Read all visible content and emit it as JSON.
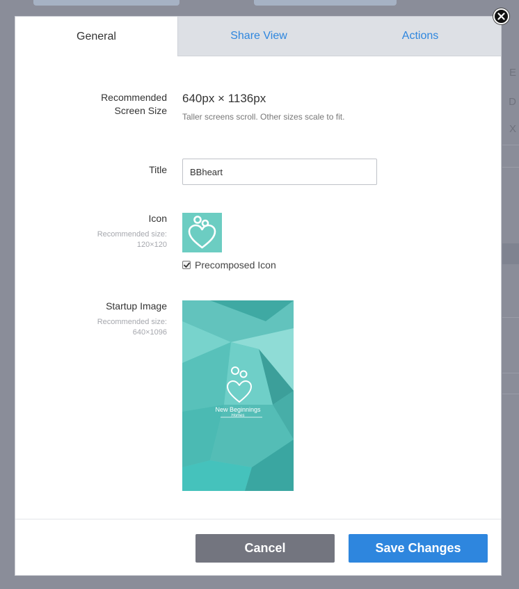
{
  "tabs": [
    {
      "label": "General",
      "active": true
    },
    {
      "label": "Share View",
      "active": false
    },
    {
      "label": "Actions",
      "active": false
    }
  ],
  "screen": {
    "label_line1": "Recommended",
    "label_line2": "Screen Size",
    "size": "640px × 1136px",
    "hint": "Taller screens scroll. Other sizes scale to fit."
  },
  "title_field": {
    "label": "Title",
    "value": "BBheart"
  },
  "icon": {
    "label": "Icon",
    "rec_line1": "Recommended size:",
    "rec_line2": "120×120",
    "precomposed_label": "Precomposed Icon",
    "precomposed_checked": true,
    "icon_name": "heart-bubbles-logo"
  },
  "startup": {
    "label": "Startup Image",
    "rec_line1": "Recommended size:",
    "rec_line2": "640×1096",
    "brand_name": "New Beginnings",
    "brand_sub": "Homes"
  },
  "footer": {
    "cancel_label": "Cancel",
    "save_label": "Save Changes"
  },
  "background": {
    "side_letters": [
      "E",
      "D",
      "X"
    ]
  },
  "colors": {
    "accent": "#2e86de",
    "teal": "#6ccdc2",
    "cancel": "#73757f"
  }
}
